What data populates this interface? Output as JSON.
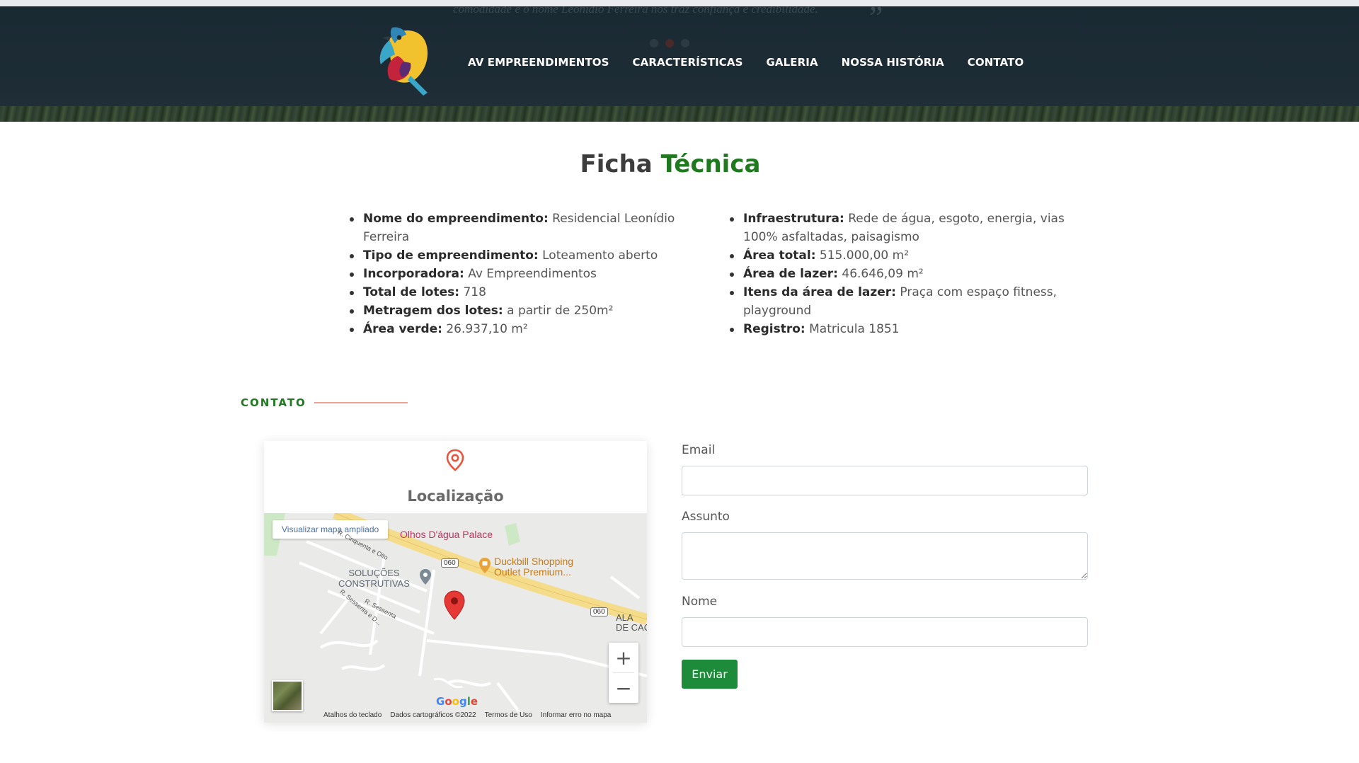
{
  "header": {
    "ghost_text": "comodidade e o nome Leonídio Ferreira nos traz confiança e credibilidade.",
    "nav": [
      {
        "label": "AV EMPREENDIMENTOS"
      },
      {
        "label": "CARACTERÍSTICAS"
      },
      {
        "label": "GALERIA"
      },
      {
        "label": "NOSSA HISTÓRIA"
      },
      {
        "label": "CONTATO"
      }
    ]
  },
  "ficha": {
    "title_plain": "Ficha",
    "title_accent": "Técnica",
    "left": [
      {
        "label": "Nome do empreendimento:",
        "value": "Residencial Leonídio Ferreira"
      },
      {
        "label": "Tipo de empreendimento:",
        "value": "Loteamento aberto"
      },
      {
        "label": "Incorporadora:",
        "value": "Av Empreendimentos"
      },
      {
        "label": "Total de lotes:",
        "value": "718"
      },
      {
        "label": "Metragem dos lotes:",
        "value": "a partir de 250m²"
      },
      {
        "label": "Área verde:",
        "value": "26.937,10 m²"
      }
    ],
    "right": [
      {
        "label": "Infraestrutura:",
        "value": "Rede de água, esgoto, energia, vias 100% asfaltadas, paisagismo"
      },
      {
        "label": "Área total:",
        "value": "515.000,00 m²"
      },
      {
        "label": "Área de lazer:",
        "value": "46.646,09 m²"
      },
      {
        "label": "Itens da área de lazer:",
        "value": "Praça com espaço fitness, playground"
      },
      {
        "label": "Registro:",
        "value": "Matricula 1851"
      }
    ]
  },
  "contato": {
    "section_label": "CONTATO",
    "map": {
      "title": "Localização",
      "view_larger": "Visualizar mapa ampliado",
      "poi_olhos": "Olhos D'água Palace",
      "poi_duckbill_1": "Duckbill Shopping",
      "poi_duckbill_2": "Outlet Premium...",
      "poi_solucoes_1": "SOLUÇÕES",
      "poi_solucoes_2": "CONSTRUTIVAS",
      "poi_ala_1": "ALA",
      "poi_ala_2": "DE CAC",
      "road_1": "060",
      "road_2": "060",
      "street_1": "R. Sessenta",
      "street_2": "R. Sessenta e D...",
      "street_3": "R. Cinquenta e Oito",
      "zoom_in": "+",
      "zoom_out": "−",
      "google": "Google",
      "footer": [
        "Atalhos do teclado",
        "Dados cartográficos ©2022",
        "Termos de Uso",
        "Informar erro no mapa"
      ]
    },
    "form": {
      "email_label": "Email",
      "subject_label": "Assunto",
      "name_label": "Nome",
      "submit_label": "Enviar"
    }
  },
  "colors": {
    "accent_green": "#1f7a1f",
    "button_green": "#1e8b3a",
    "header_bg": "#1a2a33",
    "divider_coral": "#f0a090"
  }
}
